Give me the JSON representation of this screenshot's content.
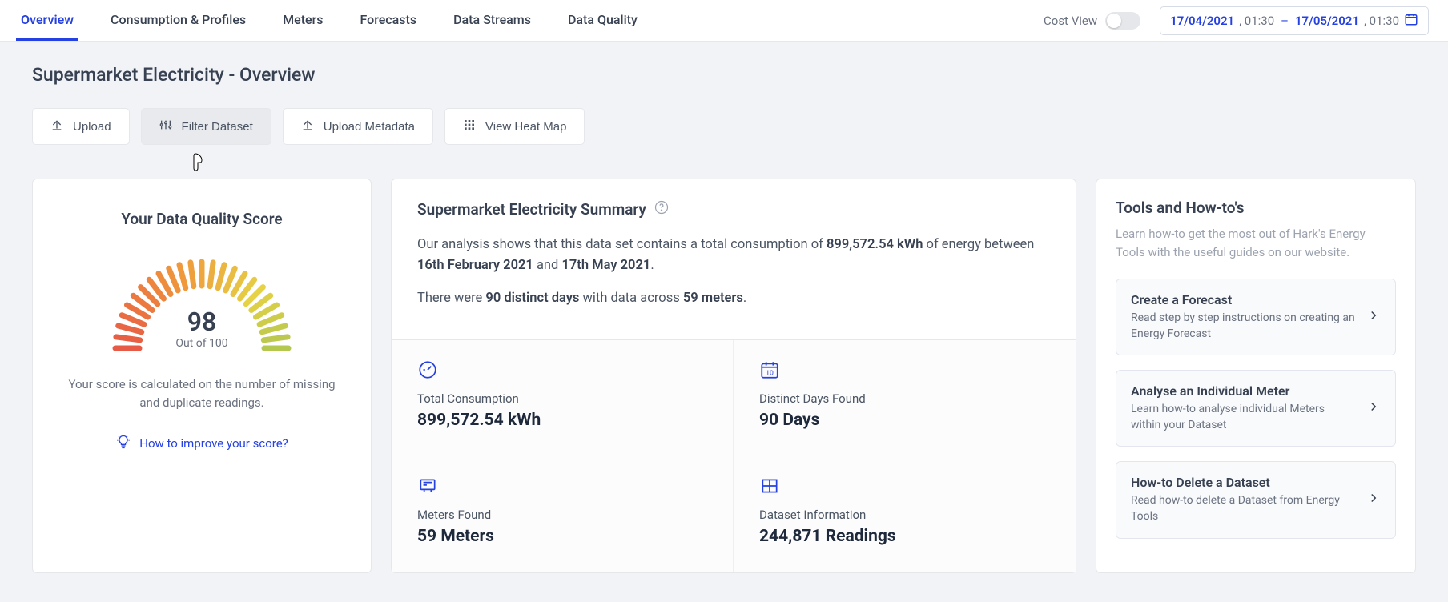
{
  "tabs": [
    "Overview",
    "Consumption & Profiles",
    "Meters",
    "Forecasts",
    "Data Streams",
    "Data Quality"
  ],
  "activeTab": 0,
  "costView": {
    "label": "Cost View",
    "on": false
  },
  "dateRange": {
    "fromDate": "17/04/2021",
    "fromTime": "01:30",
    "toDate": "17/05/2021",
    "toTime": "01:30"
  },
  "pageTitle": "Supermarket Electricity - Overview",
  "actions": {
    "upload": "Upload",
    "filter": "Filter Dataset",
    "uploadMeta": "Upload Metadata",
    "heatmap": "View Heat Map"
  },
  "quality": {
    "title": "Your Data Quality Score",
    "score": "98",
    "outOf": "Out of 100",
    "desc": "Your score is calculated on the number of missing and duplicate readings.",
    "improve": "How to improve your score?"
  },
  "summary": {
    "title": "Supermarket Electricity Summary",
    "line1_a": "Our analysis shows that this data set contains a total consumption of ",
    "line1_b": "899,572.54 kWh",
    "line1_c": " of energy between ",
    "line1_d": "16th February 2021",
    "line1_e": " and ",
    "line1_f": "17th May 2021",
    "line1_g": ".",
    "line2_a": "There were ",
    "line2_b": "90 distinct days",
    "line2_c": " with data across ",
    "line2_d": "59 meters",
    "line2_e": ".",
    "stats": {
      "consumption": {
        "label": "Total Consumption",
        "value": "899,572.54 kWh"
      },
      "days": {
        "label": "Distinct Days Found",
        "value": "90 Days"
      },
      "meters": {
        "label": "Meters Found",
        "value": "59 Meters"
      },
      "readings": {
        "label": "Dataset Information",
        "value": "244,871 Readings"
      }
    }
  },
  "tools": {
    "title": "Tools and How-to's",
    "desc": "Learn how-to get the most out of Hark's Energy Tools with the useful guides on our website.",
    "items": [
      {
        "title": "Create a Forecast",
        "desc": "Read step by step instructions on creating an Energy Forecast"
      },
      {
        "title": "Analyse an Individual Meter",
        "desc": "Learn how-to analyse individual Meters within your Dataset"
      },
      {
        "title": "How-to Delete a Dataset",
        "desc": "Read how-to delete a Dataset from Energy Tools"
      }
    ]
  }
}
